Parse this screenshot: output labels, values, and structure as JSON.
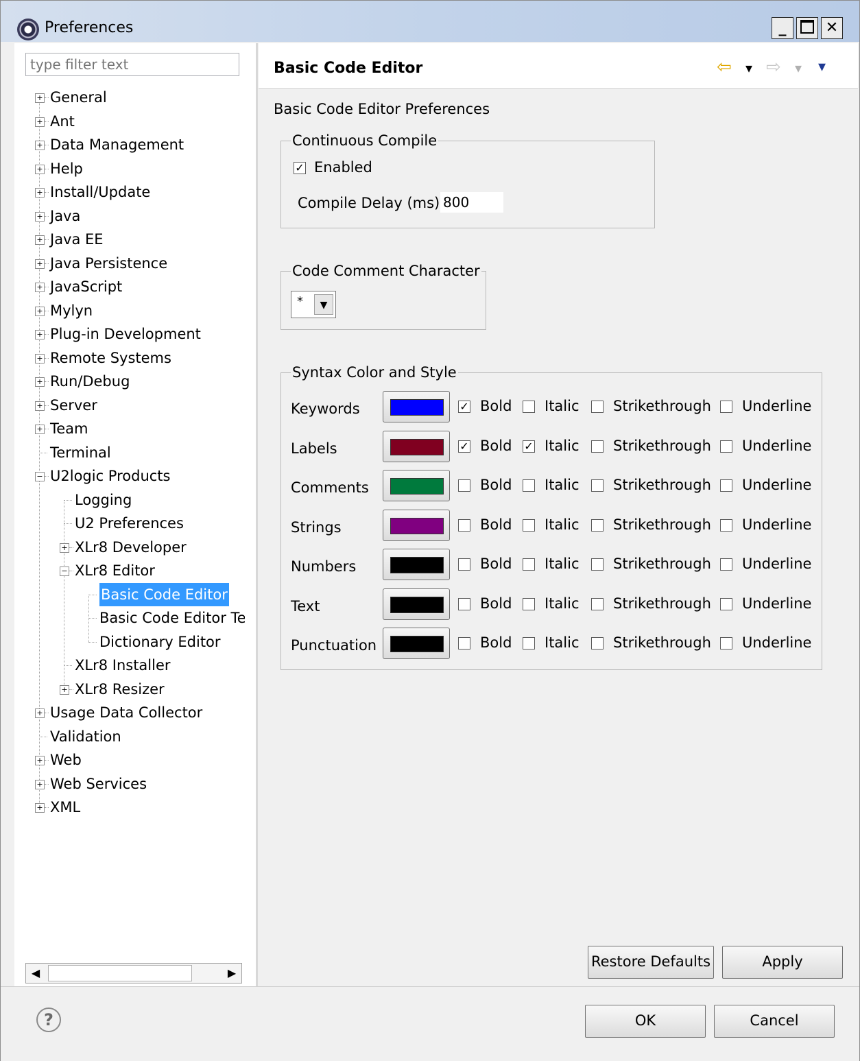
{
  "window": {
    "title": "Preferences",
    "min_label": "_",
    "close_label": "✕"
  },
  "filter": {
    "placeholder": "type filter text"
  },
  "tree": {
    "items": [
      {
        "label": "General",
        "expander": "+"
      },
      {
        "label": "Ant",
        "expander": "+"
      },
      {
        "label": "Data Management",
        "expander": "+"
      },
      {
        "label": "Help",
        "expander": "+"
      },
      {
        "label": "Install/Update",
        "expander": "+"
      },
      {
        "label": "Java",
        "expander": "+"
      },
      {
        "label": "Java EE",
        "expander": "+"
      },
      {
        "label": "Java Persistence",
        "expander": "+"
      },
      {
        "label": "JavaScript",
        "expander": "+"
      },
      {
        "label": "Mylyn",
        "expander": "+"
      },
      {
        "label": "Plug-in Development",
        "expander": "+"
      },
      {
        "label": "Remote Systems",
        "expander": "+"
      },
      {
        "label": "Run/Debug",
        "expander": "+"
      },
      {
        "label": "Server",
        "expander": "+"
      },
      {
        "label": "Team",
        "expander": "+"
      },
      {
        "label": "Terminal",
        "expander": ""
      },
      {
        "label": "U2logic Products",
        "expander": "−"
      },
      {
        "label": "Logging",
        "expander": ""
      },
      {
        "label": "U2 Preferences",
        "expander": ""
      },
      {
        "label": "XLr8 Developer",
        "expander": "+"
      },
      {
        "label": "XLr8 Editor",
        "expander": "−"
      },
      {
        "label": "Basic Code Editor",
        "expander": ""
      },
      {
        "label": "Basic Code Editor Te",
        "expander": ""
      },
      {
        "label": "Dictionary Editor",
        "expander": ""
      },
      {
        "label": "XLr8 Installer",
        "expander": ""
      },
      {
        "label": "XLr8 Resizer",
        "expander": "+"
      },
      {
        "label": "Usage Data Collector",
        "expander": "+"
      },
      {
        "label": "Validation",
        "expander": ""
      },
      {
        "label": "Web",
        "expander": "+"
      },
      {
        "label": "Web Services",
        "expander": "+"
      },
      {
        "label": "XML",
        "expander": "+"
      }
    ]
  },
  "scrollbar": {
    "left_arrow": "◀",
    "right_arrow": "▶"
  },
  "page": {
    "title": "Basic Code Editor",
    "description": "Basic Code Editor Preferences",
    "nav": {
      "back": "⇦",
      "back_menu": "▾",
      "forward": "⇨",
      "forward_menu": "▾",
      "view_menu": "▾"
    }
  },
  "continuous_compile": {
    "legend": "Continuous Compile",
    "enabled_label": "Enabled",
    "enabled_mark": "✓",
    "delay_label": "Compile Delay (ms)",
    "delay_value": "800"
  },
  "comment_char": {
    "legend": "Code Comment Character",
    "value": "*",
    "arrow": "▼"
  },
  "syntax": {
    "legend": "Syntax Color and Style",
    "option_labels": {
      "bold": "Bold",
      "italic": "Italic",
      "strike": "Strikethrough",
      "underline": "Underline"
    },
    "rows": [
      {
        "label": "Keywords",
        "color": "#0000ff",
        "bold": "✓",
        "italic": "",
        "strike": "",
        "underline": ""
      },
      {
        "label": "Labels",
        "color": "#800020",
        "bold": "✓",
        "italic": "✓",
        "strike": "",
        "underline": ""
      },
      {
        "label": "Comments",
        "color": "#007a3d",
        "bold": "",
        "italic": "",
        "strike": "",
        "underline": ""
      },
      {
        "label": "Strings",
        "color": "#800080",
        "bold": "",
        "italic": "",
        "strike": "",
        "underline": ""
      },
      {
        "label": "Numbers",
        "color": "#000000",
        "bold": "",
        "italic": "",
        "strike": "",
        "underline": ""
      },
      {
        "label": "Text",
        "color": "#000000",
        "bold": "",
        "italic": "",
        "strike": "",
        "underline": ""
      },
      {
        "label": "Punctuation",
        "color": "#000000",
        "bold": "",
        "italic": "",
        "strike": "",
        "underline": ""
      }
    ]
  },
  "buttons": {
    "restore_defaults": "Restore Defaults",
    "apply": "Apply",
    "ok": "OK",
    "cancel": "Cancel",
    "help": "?"
  }
}
